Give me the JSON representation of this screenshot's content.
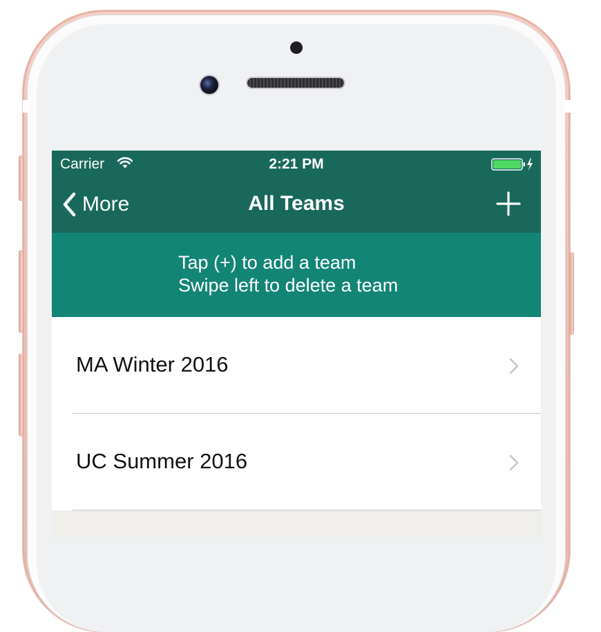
{
  "status_bar": {
    "carrier": "Carrier",
    "time": "2:21 PM",
    "battery_color": "#4cd964",
    "icons": [
      "wifi-icon",
      "battery-icon",
      "charging-bolt-icon"
    ]
  },
  "nav": {
    "back_label": "More",
    "title": "All Teams",
    "add_icon": "plus-icon",
    "back_icon": "chevron-left-icon"
  },
  "banner": {
    "line1": "Tap (+) to add a team",
    "line2": "Swipe left to delete a team"
  },
  "teams": [
    {
      "name": "MA Winter 2016"
    },
    {
      "name": "UC Summer 2016"
    }
  ],
  "colors": {
    "nav_background": "#19695a",
    "banner_background": "#138575",
    "list_background": "#ffffff",
    "separator": "#c8c7cc",
    "chevron": "#c7c7cc",
    "phone_frame": "#eec2b8"
  }
}
